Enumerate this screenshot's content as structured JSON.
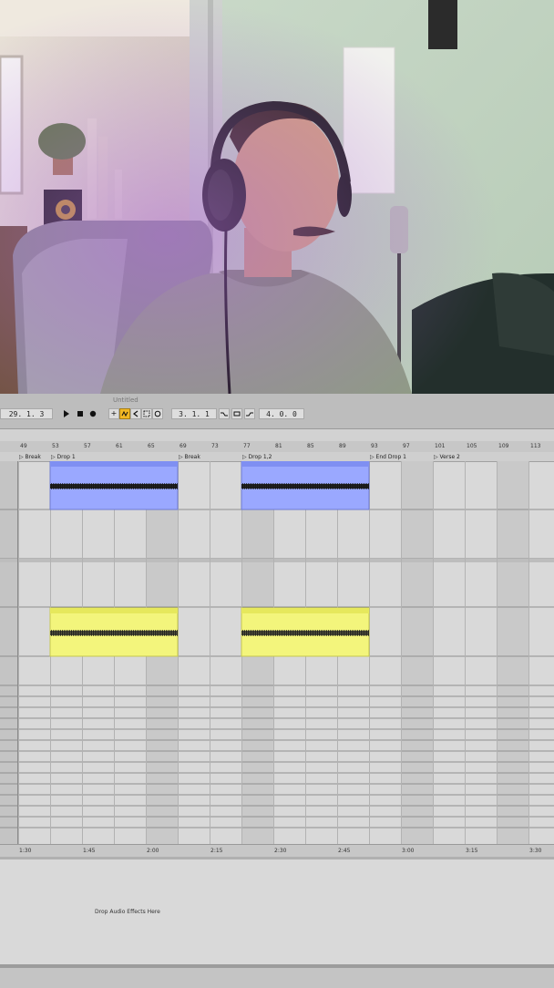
{
  "daw": {
    "doc_title": "Untitled",
    "position": "29. 1. 3",
    "loop_start": "3. 1. 1",
    "loop_length": "4. 0. 0",
    "bar_numbers": [
      "49",
      "53",
      "57",
      "61",
      "65",
      "69",
      "73",
      "77",
      "81",
      "85",
      "89",
      "93",
      "97",
      "101",
      "105",
      "109",
      "113"
    ],
    "locators": [
      "Break",
      "Drop 1",
      "Break",
      "Drop 1,2",
      "End Drop 1",
      "Verse 2"
    ],
    "time_labels": [
      "1:30",
      "1:45",
      "2:00",
      "2:15",
      "2:30",
      "2:45",
      "3:00",
      "3:15",
      "3:30"
    ],
    "drop_hint": "Drop Audio Effects Here",
    "clip_colors": {
      "blue": "#9aa8ff",
      "yellow": "#f3f57c",
      "transport_on": "#f2b824"
    }
  }
}
